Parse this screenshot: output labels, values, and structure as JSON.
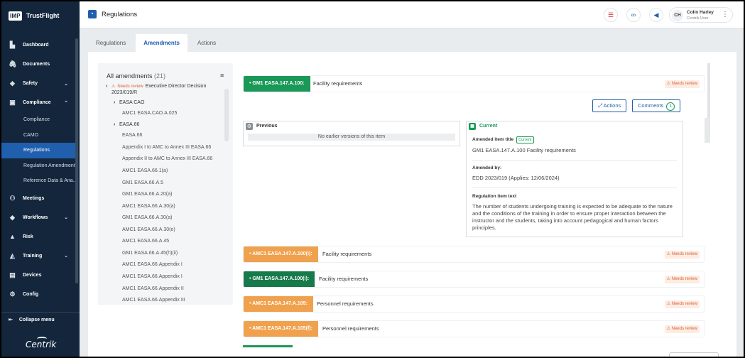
{
  "brand": {
    "logo": "IMP",
    "name": "TrustFlight"
  },
  "sidebar": {
    "items": [
      {
        "label": "Dashboard",
        "icon": "▙"
      },
      {
        "label": "Documents",
        "icon": "🖇"
      },
      {
        "label": "Safety",
        "icon": "◈",
        "chevron": "⌄"
      },
      {
        "label": "Compliance",
        "icon": "▣",
        "chevron": "⌃"
      }
    ],
    "compliance_sub": [
      "Compliance",
      "CAMO",
      "Regulations",
      "Regulation Amendments",
      "Reference Data & Ana..."
    ],
    "items2": [
      {
        "label": "Meetings",
        "icon": "⚇"
      },
      {
        "label": "Workflows",
        "icon": "◆",
        "chevron": "⌄"
      },
      {
        "label": "Risk",
        "icon": "▲"
      },
      {
        "label": "Training",
        "icon": "◭",
        "chevron": "⌄"
      },
      {
        "label": "Devices",
        "icon": "▤"
      },
      {
        "label": "Config",
        "icon": "⚙"
      }
    ],
    "collapse_label": "Collapse menu",
    "footer_logo": "Centrik"
  },
  "topbar": {
    "title": "Regulations",
    "user": {
      "initials": "CH",
      "name": "Colin Harley",
      "role": "Centrik User"
    }
  },
  "tabs": [
    "Regulations",
    "Amendments",
    "Actions"
  ],
  "amendments_list": {
    "title": "All amendments",
    "count": "(21)",
    "items": [
      {
        "text": "Executive Director Decision",
        "badge": "Needs review",
        "caret": "›",
        "indent": 0
      },
      {
        "text": "2023/019/R",
        "indent": 0
      },
      {
        "text": "EASA CAO",
        "caret": "›",
        "indent": 1
      },
      {
        "text": "AMC1 EASA.CAO.A.025",
        "indent": 2
      },
      {
        "text": "EASA.66",
        "caret": "›",
        "indent": 1
      },
      {
        "text": "EASA.66",
        "indent": 2
      },
      {
        "text": "Appendix I to AMC to Annex III EASA.66",
        "indent": 2
      },
      {
        "text": "Appendix II to AMC to Annex III EASA.66",
        "indent": 2
      },
      {
        "text": "AMC1 EASA.66.1(a)",
        "indent": 2
      },
      {
        "text": "GM1 EASA.66.A.5",
        "indent": 2
      },
      {
        "text": "GM1 EASA.66.A.20(a)",
        "indent": 2
      },
      {
        "text": "AMC1 EASA.66.A.30(a)",
        "indent": 2
      },
      {
        "text": "GM1 EASA.66.A.30(a)",
        "indent": 2
      },
      {
        "text": "AMC1 EASA.66.A.30(e)",
        "indent": 2
      },
      {
        "text": "AMC1 EASA.66.A.45",
        "indent": 2
      },
      {
        "text": "GM1 EASA.66.A.45(h)(ii)",
        "indent": 2
      },
      {
        "text": "AMC1 EASA.66.Appendix I",
        "indent": 2
      },
      {
        "text": "AMC1 EASA.66.Appendix I",
        "indent": 2
      },
      {
        "text": "AMC1 EASA.66.Appendix II",
        "indent": 2
      },
      {
        "text": "AMC1 EASA.66.Appendix III",
        "indent": 2
      }
    ]
  },
  "detail": {
    "header_tag": "• GM1 EASA.147.A.100:",
    "header_desc": "Facility requirements",
    "header_badge": "Needs review",
    "actions_label": "Actions",
    "comments_label": "Comments",
    "comments_count": "1",
    "previous": {
      "title": "Previous",
      "empty": "No earlier versions of this item"
    },
    "current": {
      "title": "Current",
      "amended_title_label": "Amended item title",
      "chip": "Current",
      "amended_title_value": "GM1 EASA.147.A.100 Facility requirements",
      "amended_by_label": "Amended by:",
      "amended_by_value": "EDD 2023/019 (Applies: 12/06/2024)",
      "reg_text_label": "Regulation item text",
      "reg_text": "The number of students undergoing training is expected to be adequate to the nature and the conditions of the training in order to ensure proper interaction between the instructor and the students, taking into account pedagogical and human factors principles."
    }
  },
  "rows": [
    {
      "tag": "• AMC1 EASA.147.A.100(i):",
      "desc": "Facility requirements",
      "badge": "Needs review",
      "color": "orange"
    },
    {
      "tag": "• GM1 EASA.147.A.100(i):",
      "desc": "Facility requirements",
      "badge": "Needs review",
      "color": "darkgreen"
    },
    {
      "tag": "• AMC1 EASA.147.A.105:",
      "desc": "Personnel requirements",
      "badge": "Needs review",
      "color": "orange"
    },
    {
      "tag": "• AMC1 EASA.147.A.105(f):",
      "desc": "Personnel requirements",
      "badge": "Needs review",
      "color": "orange"
    }
  ],
  "colors": {
    "sidebar": "#13263c",
    "accent": "#1f5fad",
    "green": "#1a9857",
    "orange": "#f0a14d",
    "warning": "#d9623a"
  }
}
